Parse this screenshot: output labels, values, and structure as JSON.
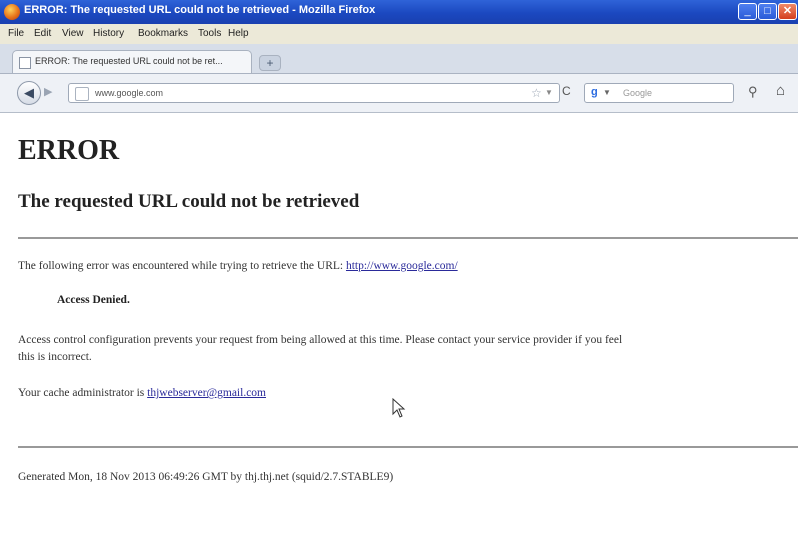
{
  "window": {
    "title": "ERROR: The requested URL could not be retrieved - Mozilla Firefox",
    "minimize": "_",
    "maximize": "□",
    "close": "✕"
  },
  "menu": [
    "File",
    "Edit",
    "View",
    "History",
    "Bookmarks",
    "Tools",
    "Help"
  ],
  "tab": {
    "label": "ERROR: The requested URL could not be ret...",
    "new_tab": "+"
  },
  "nav": {
    "back": "◀",
    "forward": "▶",
    "url": "www.google.com",
    "star": "☆",
    "reload": "C",
    "search_engine": "g",
    "search_placeholder": "Google",
    "search_icon": "magnifier-icon",
    "home_icon": "home-icon"
  },
  "page": {
    "heading": "ERROR",
    "subheading": "The requested URL could not be retrieved",
    "error_intro": "The following error was encountered while trying to retrieve the URL: ",
    "error_url": "http://www.google.com/",
    "denied": "Access Denied.",
    "policy_line1": "Access control configuration prevents your request from being allowed at this time. Please contact your service provider if you feel",
    "policy_line2": "this is incorrect.",
    "admin_text": "Your cache administrator is ",
    "admin_email": "thjwebserver@gmail.com",
    "generated": "Generated Mon, 18 Nov 2013 06:49:26 GMT by thj.thj.net (squid/2.7.STABLE9)"
  },
  "colors": {
    "titlebar": "#1b48c0",
    "link": "#2a2a9a",
    "menubar": "#ece9d8"
  }
}
